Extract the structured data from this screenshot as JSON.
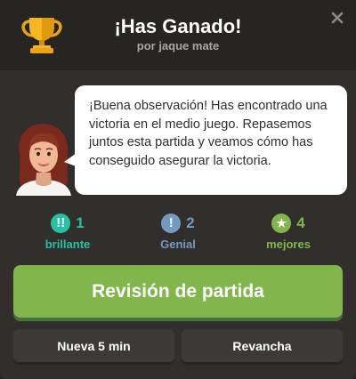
{
  "header": {
    "title": "¡Has Ganado!",
    "subtitle": "por jaque mate",
    "trophy_icon": "trophy-icon",
    "close_icon": "close-icon"
  },
  "coach": {
    "avatar_icon": "coach-avatar",
    "message": "¡Buena observación! Has encontrado una victoria en el medio juego. Repasemos juntos esta partida y veamos cómo has conseguido asegurar la victoria."
  },
  "stats": [
    {
      "icon": "double-exclamation-icon",
      "glyph": "!!",
      "count": "1",
      "label": "brillante",
      "color": "#26c2a3"
    },
    {
      "icon": "exclamation-icon",
      "glyph": "!",
      "count": "2",
      "label": "Genial",
      "color": "#749bbf"
    },
    {
      "icon": "star-icon",
      "glyph": "★",
      "count": "4",
      "label": "mejores",
      "color": "#81b64c"
    }
  ],
  "buttons": {
    "review": "Revisión de partida",
    "new_game": "Nueva 5 min",
    "rematch": "Revancha"
  },
  "colors": {
    "header_bg": "#272522",
    "panel_bg": "#312e2b",
    "primary_button": "#81b64c",
    "secondary_button": "#3c3a37"
  }
}
